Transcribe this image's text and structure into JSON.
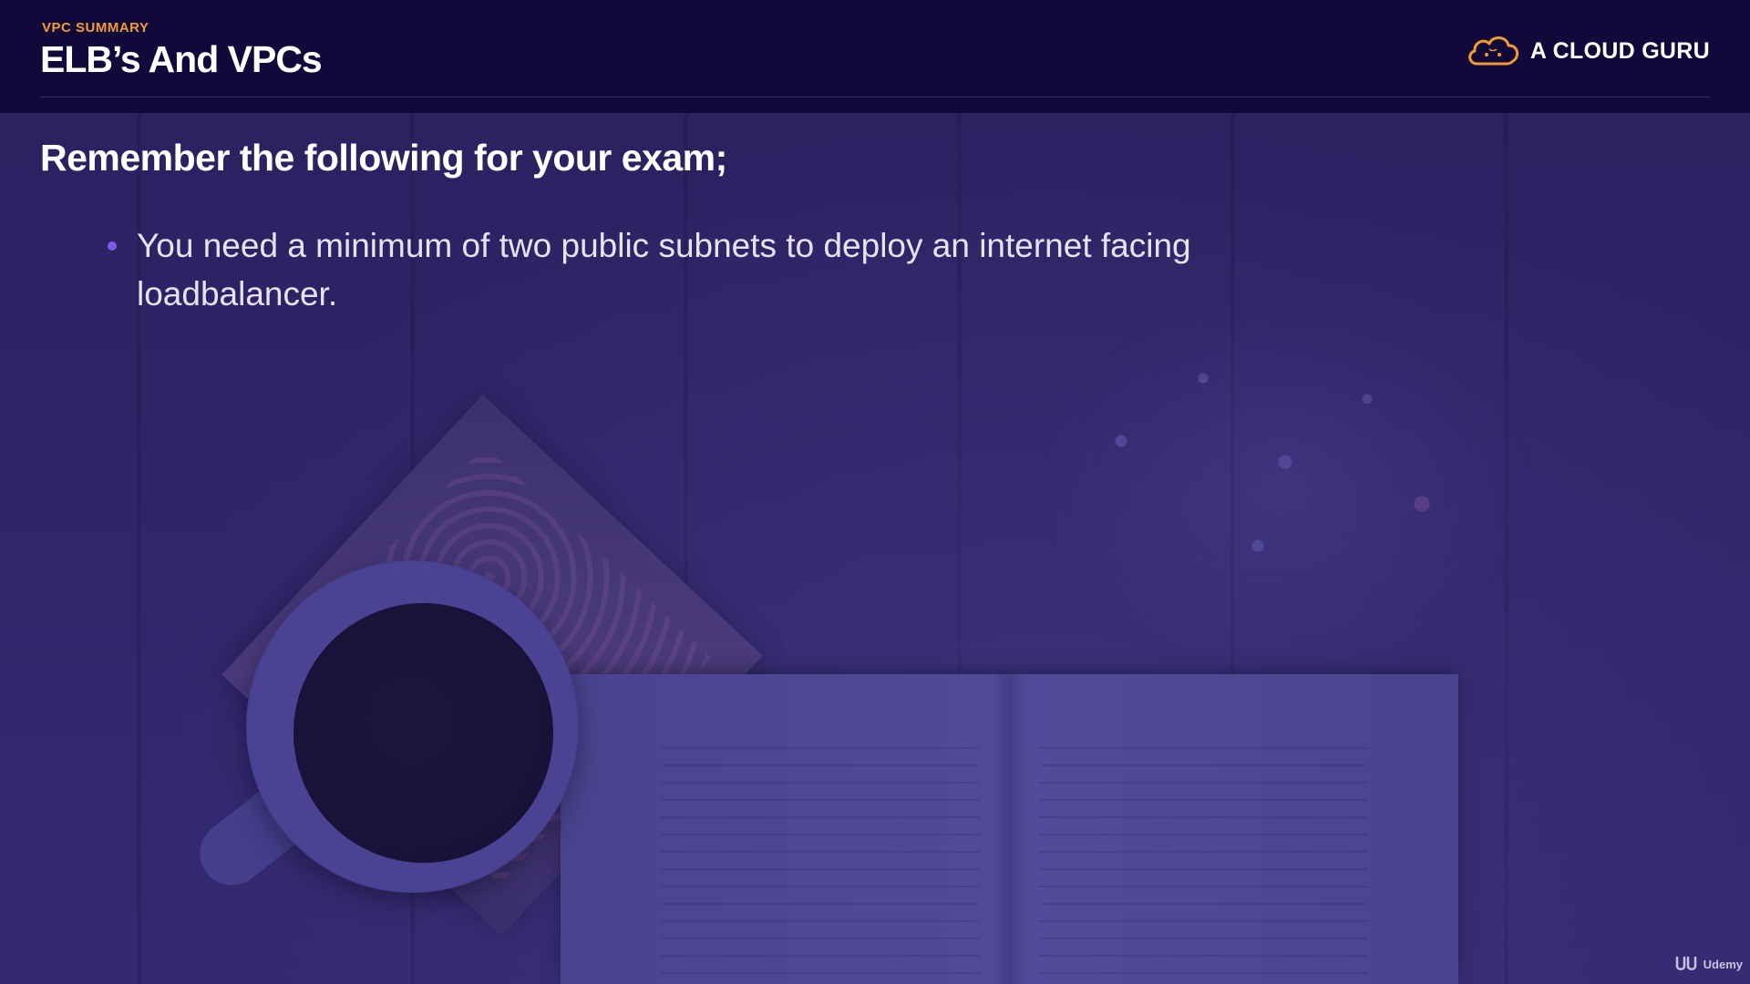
{
  "header": {
    "kicker": "VPC SUMMARY",
    "title": "ELB’s And VPCs",
    "brand_name": "A CLOUD GURU",
    "brand_logo_icon": "cloud-icon"
  },
  "content": {
    "heading": "Remember the following for your exam;",
    "bullets": [
      {
        "text": "You need a minimum of two public subnets to deploy an internet facing loadbalancer."
      }
    ]
  },
  "watermark": {
    "text": "Udemy",
    "logo_icon": "udemy-logo-icon"
  },
  "colors": {
    "header_bg": "#10093a",
    "kicker": "#f39b33",
    "accent_bullet": "#7d5af0",
    "brand_logo": "#f39b33",
    "background_tint": "#2e2466"
  }
}
